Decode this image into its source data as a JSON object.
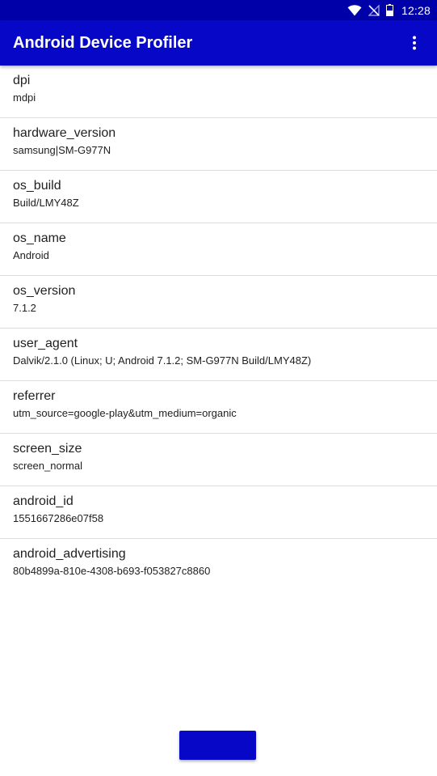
{
  "status_bar": {
    "time": "12:28",
    "icons": [
      "wifi-icon",
      "no-signal-icon",
      "battery-icon"
    ]
  },
  "app_bar": {
    "title": "Android Device Profiler",
    "menu_icon": "overflow-menu-icon"
  },
  "profile": {
    "items": [
      {
        "key": "dpi",
        "value": "mdpi"
      },
      {
        "key": "hardware_version",
        "value": "samsung|SM-G977N"
      },
      {
        "key": "os_build",
        "value": "Build/LMY48Z"
      },
      {
        "key": "os_name",
        "value": "Android"
      },
      {
        "key": "os_version",
        "value": "7.1.2"
      },
      {
        "key": "user_agent",
        "value": "Dalvik/2.1.0 (Linux; U; Android 7.1.2; SM-G977N Build/LMY48Z)"
      },
      {
        "key": "referrer",
        "value": "utm_source=google-play&utm_medium=organic"
      },
      {
        "key": "screen_size",
        "value": "screen_normal"
      },
      {
        "key": "android_id",
        "value": "1551667286e07f58"
      },
      {
        "key": "android_advertising",
        "value": "80b4899a-810e-4308-b693-f053827c8860"
      }
    ]
  },
  "bottom_button": {
    "label": ""
  },
  "colors": {
    "status_bar": "#0000a8",
    "app_bar": "#0707c7",
    "button": "#0707c7",
    "divider": "#dcdcdc",
    "text": "#212121"
  }
}
